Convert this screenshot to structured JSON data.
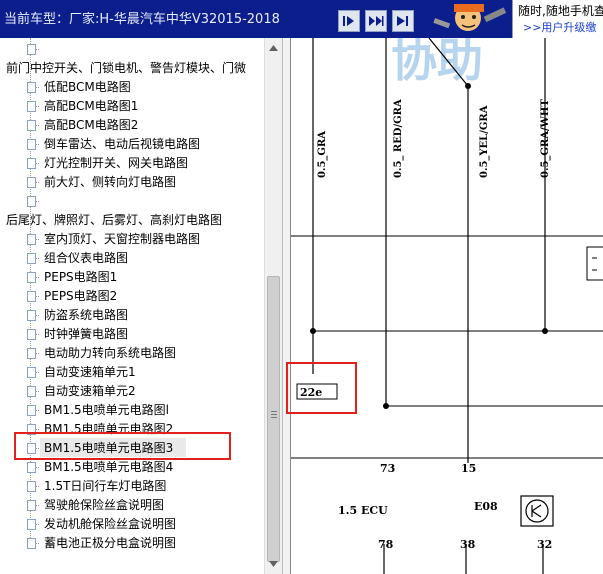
{
  "header": {
    "title": "当前车型：厂家:H-华晨汽车中华V32015-2018",
    "ad_line1": "随时,随地手机查",
    "ad_line2": ">>用户升级缴",
    "brand_text": "协助"
  },
  "tree": {
    "items": [
      {
        "label": "",
        "kind": "child"
      },
      {
        "label": "前门中控开关、门锁电机、警告灯模块、门微",
        "kind": "group"
      },
      {
        "label": "低配BCM电路图",
        "kind": "child"
      },
      {
        "label": "高配BCM电路图1",
        "kind": "child"
      },
      {
        "label": "高配BCM电路图2",
        "kind": "child"
      },
      {
        "label": "倒车雷达、电动后视镜电路图",
        "kind": "child"
      },
      {
        "label": "灯光控制开关、网关电路图",
        "kind": "child"
      },
      {
        "label": "前大灯、侧转向灯电路图",
        "kind": "child"
      },
      {
        "label": "",
        "kind": "child"
      },
      {
        "label": "后尾灯、牌照灯、后雾灯、高刹灯电路图",
        "kind": "group"
      },
      {
        "label": "室内顶灯、天窗控制器电路图",
        "kind": "child"
      },
      {
        "label": "组合仪表电路图",
        "kind": "child"
      },
      {
        "label": "PEPS电路图1",
        "kind": "child"
      },
      {
        "label": "PEPS电路图2",
        "kind": "child"
      },
      {
        "label": "防盗系统电路图",
        "kind": "child"
      },
      {
        "label": "时钟弹簧电路图",
        "kind": "child"
      },
      {
        "label": "电动助力转向系统电路图",
        "kind": "child"
      },
      {
        "label": "自动变速箱单元1",
        "kind": "child"
      },
      {
        "label": "自动变速箱单元2",
        "kind": "child"
      },
      {
        "label": "BM1.5电喷单元电路图l",
        "kind": "child"
      },
      {
        "label": "BM1.5电喷单元电路图2",
        "kind": "child"
      },
      {
        "label": "BM1.5电喷单元电路图3",
        "kind": "child",
        "selected": true
      },
      {
        "label": "BM1.5电喷单元电路图4",
        "kind": "child"
      },
      {
        "label": "1.5T日间行车灯电路图",
        "kind": "child"
      },
      {
        "label": "驾驶舱保险丝盒说明图",
        "kind": "child"
      },
      {
        "label": "发动机舱保险丝盒说明图",
        "kind": "child"
      },
      {
        "label": "蓄电池正极分电盒说明图",
        "kind": "child"
      }
    ]
  },
  "diagram": {
    "wire_labels": [
      "0.5_GRA",
      "0.5_ RED/GRA",
      "0.5_YEL/GRA",
      "0.5_GRA/WHT"
    ],
    "connector_label": "22e",
    "pin_top": [
      "73",
      "15"
    ],
    "ecu_label": "1.5 ECU",
    "component_label": "E08",
    "pin_bottom": [
      "78",
      "38",
      "32"
    ]
  },
  "colors": {
    "header_bg": "#0b1e8c",
    "highlight": "#e2201c",
    "ad_link": "#1a3fd0"
  }
}
